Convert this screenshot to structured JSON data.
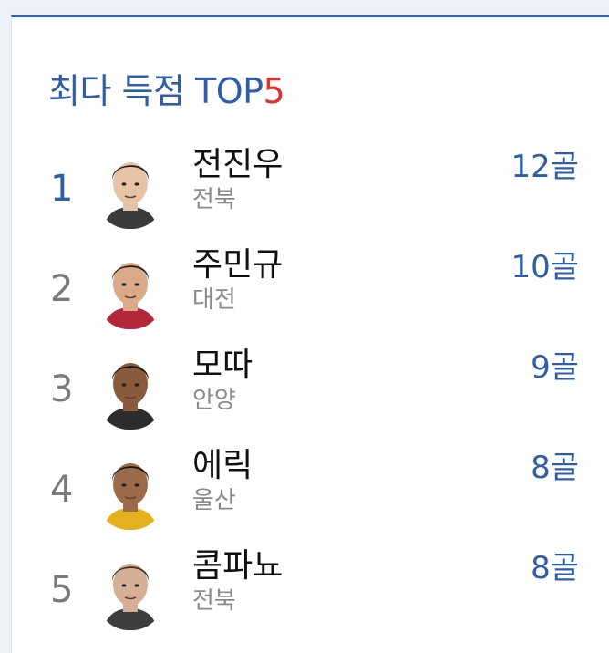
{
  "widget": {
    "title_main": "최다 득점 TOP",
    "title_accent": "5"
  },
  "players": [
    {
      "rank": "1",
      "name": "전진우",
      "team": "전북",
      "goals": "12골",
      "skin": "#e7c3a6",
      "hair": "#1c1c1c",
      "shirt": "#3b3b3b"
    },
    {
      "rank": "2",
      "name": "주민규",
      "team": "대전",
      "goals": "10골",
      "skin": "#d9ab8a",
      "hair": "#1b1b1b",
      "shirt": "#b2283a"
    },
    {
      "rank": "3",
      "name": "모따",
      "team": "안양",
      "goals": "9골",
      "skin": "#8a5a3c",
      "hair": "#141414",
      "shirt": "#2c2c2c"
    },
    {
      "rank": "4",
      "name": "에릭",
      "team": "울산",
      "goals": "8골",
      "skin": "#9a6a49",
      "hair": "#141414",
      "shirt": "#e2b11d"
    },
    {
      "rank": "5",
      "name": "콤파뇨",
      "team": "전북",
      "goals": "8골",
      "skin": "#d6b096",
      "hair": "#3a2a20",
      "shirt": "#3e3e3e"
    }
  ],
  "colors": {
    "accent_blue": "#2f5ea9",
    "accent_red": "#e0312b",
    "rank_gray": "#7a7a7a",
    "team_gray": "#8a8a8a"
  }
}
